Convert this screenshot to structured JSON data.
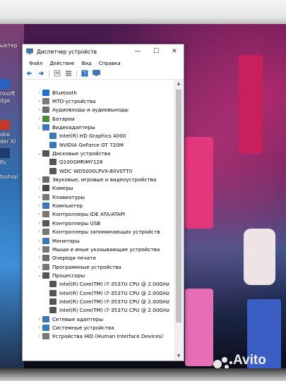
{
  "window": {
    "title": "Диспетчер устройств",
    "minimize_glyph": "—",
    "maximize_glyph": "☐",
    "close_glyph": "✕"
  },
  "menu": [
    "Файл",
    "Действие",
    "Вид",
    "Справка"
  ],
  "toolbar_icons": [
    "back-icon",
    "forward-icon",
    "properties-icon",
    "list-icon",
    "help-icon",
    "monitor-icon"
  ],
  "tree": [
    {
      "label": "Bluetooth",
      "indent": 0,
      "expanded": false,
      "icon": "bluetooth-icon",
      "color": "#1f6fd1"
    },
    {
      "label": "MTD-устройства",
      "indent": 0,
      "expanded": false,
      "icon": "device-icon",
      "color": "#7a7a7a"
    },
    {
      "label": "Аудиовходы и аудиовыходы",
      "indent": 0,
      "expanded": false,
      "icon": "speaker-icon",
      "color": "#6b6b6b"
    },
    {
      "label": "Батареи",
      "indent": 0,
      "expanded": false,
      "icon": "battery-icon",
      "color": "#4b8a3a"
    },
    {
      "label": "Видеоадаптеры",
      "indent": 0,
      "expanded": true,
      "icon": "display-adapter-icon",
      "color": "#3a78b8"
    },
    {
      "label": "Intel(R) HD Graphics 4000",
      "indent": 1,
      "expanded": null,
      "icon": "display-adapter-icon",
      "color": "#3a78b8"
    },
    {
      "label": "NVIDIA GeForce GT 720M",
      "indent": 1,
      "expanded": null,
      "icon": "display-adapter-icon",
      "color": "#3a78b8"
    },
    {
      "label": "Дисковые устройства",
      "indent": 0,
      "expanded": true,
      "icon": "disk-icon",
      "color": "#555555"
    },
    {
      "label": "Q100SMRIMY128",
      "indent": 1,
      "expanded": null,
      "icon": "disk-icon",
      "color": "#555555"
    },
    {
      "label": "WDC WD5000LPVX-80V0TT0",
      "indent": 1,
      "expanded": null,
      "icon": "disk-icon",
      "color": "#555555"
    },
    {
      "label": "Звуковые, игровые и видеоустройства",
      "indent": 0,
      "expanded": false,
      "icon": "sound-icon",
      "color": "#6b6b6b"
    },
    {
      "label": "Камеры",
      "indent": 0,
      "expanded": false,
      "icon": "camera-icon",
      "color": "#444444"
    },
    {
      "label": "Клавиатуры",
      "indent": 0,
      "expanded": false,
      "icon": "keyboard-icon",
      "color": "#777777"
    },
    {
      "label": "Компьютер",
      "indent": 0,
      "expanded": false,
      "icon": "computer-icon",
      "color": "#3a78b8"
    },
    {
      "label": "Контроллеры IDE ATA/ATAPI",
      "indent": 0,
      "expanded": false,
      "icon": "controller-icon",
      "color": "#777777"
    },
    {
      "label": "Контроллеры USB",
      "indent": 0,
      "expanded": false,
      "icon": "usb-icon",
      "color": "#555555"
    },
    {
      "label": "Контроллеры запоминающих устройств",
      "indent": 0,
      "expanded": false,
      "icon": "storage-controller-icon",
      "color": "#777777"
    },
    {
      "label": "Мониторы",
      "indent": 0,
      "expanded": false,
      "icon": "monitor-icon",
      "color": "#3a78b8"
    },
    {
      "label": "Мыши и иные указывающие устройства",
      "indent": 0,
      "expanded": false,
      "icon": "mouse-icon",
      "color": "#777777"
    },
    {
      "label": "Очереди печати",
      "indent": 0,
      "expanded": false,
      "icon": "printer-icon",
      "color": "#6b6b6b"
    },
    {
      "label": "Программные устройства",
      "indent": 0,
      "expanded": false,
      "icon": "software-device-icon",
      "color": "#777777"
    },
    {
      "label": "Процессоры",
      "indent": 0,
      "expanded": true,
      "icon": "processor-icon",
      "color": "#555555"
    },
    {
      "label": "Intel(R) Core(TM) i7-3537U CPU @ 2.00GHz",
      "indent": 1,
      "expanded": null,
      "icon": "processor-icon",
      "color": "#555555"
    },
    {
      "label": "Intel(R) Core(TM) i7-3537U CPU @ 2.00GHz",
      "indent": 1,
      "expanded": null,
      "icon": "processor-icon",
      "color": "#555555"
    },
    {
      "label": "Intel(R) Core(TM) i7-3537U CPU @ 2.00GHz",
      "indent": 1,
      "expanded": null,
      "icon": "processor-icon",
      "color": "#555555"
    },
    {
      "label": "Intel(R) Core(TM) i7-3537U CPU @ 2.00GHz",
      "indent": 1,
      "expanded": null,
      "icon": "processor-icon",
      "color": "#555555"
    },
    {
      "label": "Сетевые адаптеры",
      "indent": 0,
      "expanded": false,
      "icon": "network-icon",
      "color": "#3a78b8"
    },
    {
      "label": "Системные устройства",
      "indent": 0,
      "expanded": false,
      "icon": "system-device-icon",
      "color": "#3a78b8"
    },
    {
      "label": "Устройства HID (Human Interface Devices)",
      "indent": 0,
      "expanded": false,
      "icon": "hid-icon",
      "color": "#777777"
    }
  ],
  "desktop_icons": [
    {
      "label": "ьютер",
      "color": "#3b7bd6"
    },
    {
      "label": "rosoft",
      "color": "#2b62c2"
    },
    {
      "label": "dge",
      "color": "#2b62c2"
    },
    {
      "label": "obe",
      "color": "#c0392b"
    },
    {
      "label": "der XI",
      "color": "#c0392b"
    },
    {
      "label": "Ps",
      "color": "#1e3a6e"
    },
    {
      "label": "toshop",
      "color": "#1e3a6e"
    }
  ],
  "watermark": "Avito"
}
